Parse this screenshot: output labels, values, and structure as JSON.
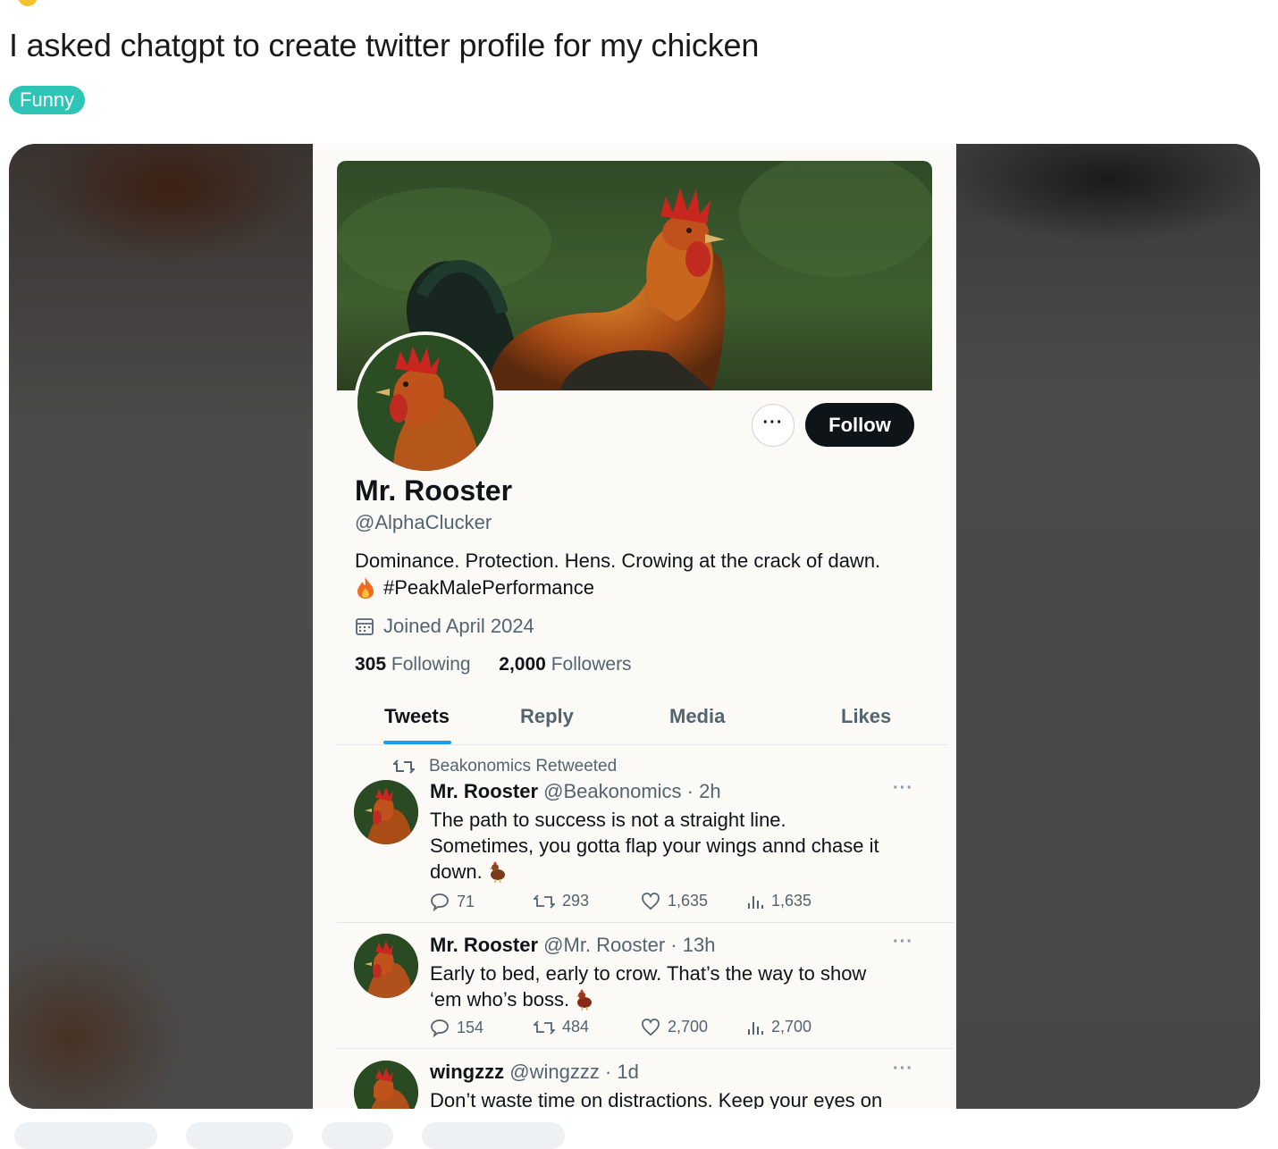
{
  "post": {
    "title": "I asked chatgpt to create twitter profile for my chicken",
    "flair": "Funny"
  },
  "profile": {
    "more_label": "···",
    "follow_label": "Follow",
    "display_name": "Mr. Rooster",
    "handle": "@AlphaClucker",
    "bio_line1": "Dominance. Protection. Hens. Crowing at the crack of dawn.",
    "bio_line2": "#PeakMalePerformance",
    "joined": "Joined April 2024",
    "following_count": "305",
    "following_label": "Following",
    "followers_count": "2,000",
    "followers_label": "Followers"
  },
  "tabs": [
    "Tweets",
    "Reply",
    "Media",
    "Likes"
  ],
  "tweets": [
    {
      "retweet_note": "Beakonomics Retweeted",
      "name": "Mr. Rooster",
      "meta": "@Beakonomics · 2h",
      "text_l1": "The path to success is not a straight line.",
      "text_l2": "Sometimes, you gotta flap your wings annd chase it",
      "text_l3": "down.",
      "replies": "71",
      "retweets": "293",
      "likes": "1,635",
      "views": "1,635"
    },
    {
      "name": "Mr. Rooster",
      "meta": "@Mr. Rooster · 13h",
      "text_l1": "Early to bed, early to crow. That’s the way to show",
      "text_l2": "‘em who’s boss.",
      "replies": "154",
      "retweets": "484",
      "likes": "2,700",
      "views": "2,700"
    },
    {
      "name": "wingzzz",
      "meta": "@wingzzz · 1d",
      "text_l1": "Don’t waste time on distractions. Keep your eyes on"
    }
  ],
  "colors": {
    "flair_bg": "#2ec4b6",
    "follow_bg": "#0f1419",
    "tab_underline": "#1d9bf0"
  },
  "icons": [
    "reply-icon",
    "retweet-icon",
    "like-icon",
    "views-icon",
    "calendar-icon",
    "fire-icon",
    "chicken-icon"
  ]
}
